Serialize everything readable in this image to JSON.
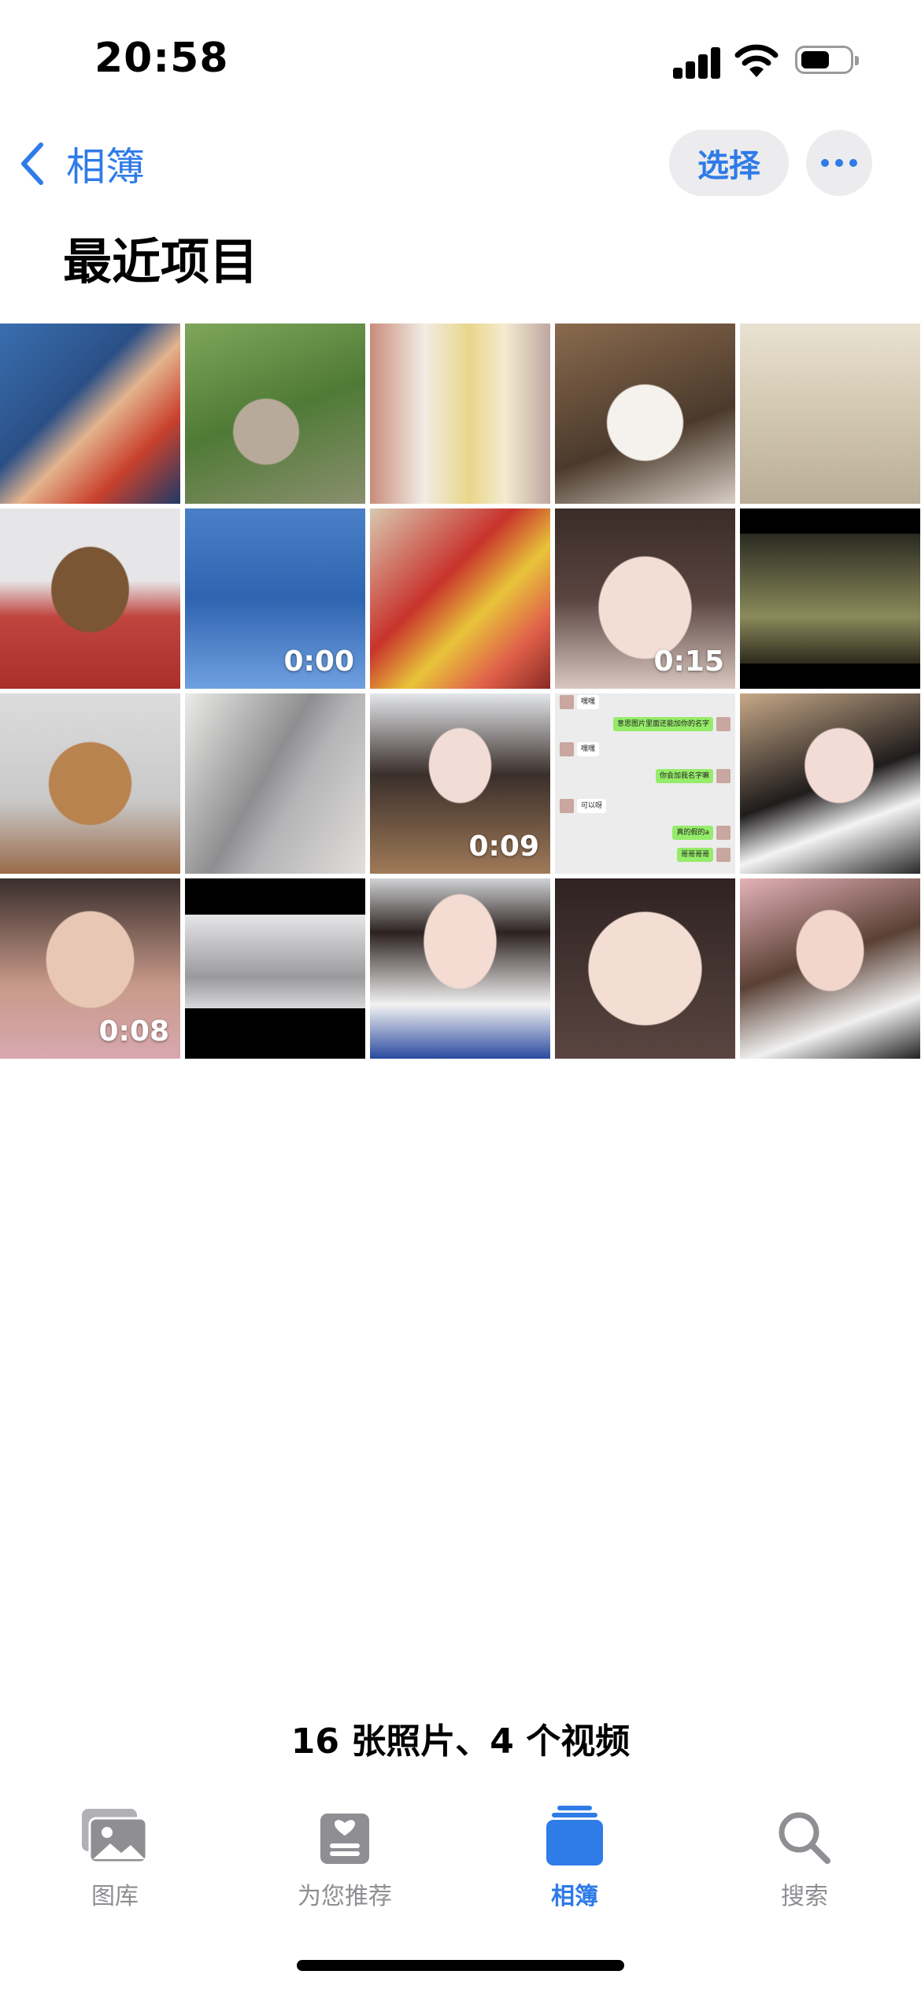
{
  "status_bar": {
    "time": "20:58",
    "battery_level": 0.6
  },
  "nav": {
    "back_label": "相簿",
    "select_label": "选择"
  },
  "page_title": "最近项目",
  "grid": [
    {
      "kind": "photo",
      "subject": "cartoon boy"
    },
    {
      "kind": "photo",
      "subject": "cat on grass"
    },
    {
      "kind": "photo",
      "subject": "two people on phone"
    },
    {
      "kind": "photo",
      "subject": "husky dog"
    },
    {
      "kind": "photo",
      "subject": "street scene"
    },
    {
      "kind": "photo",
      "subject": "dog on red carpet"
    },
    {
      "kind": "video",
      "subject": "blue water",
      "duration": "0:00"
    },
    {
      "kind": "photo",
      "subject": "snacks package"
    },
    {
      "kind": "video",
      "subject": "selfie",
      "duration": "0:15"
    },
    {
      "kind": "photo",
      "subject": "person outdoors at night"
    },
    {
      "kind": "photo",
      "subject": "dog with cap"
    },
    {
      "kind": "photo",
      "subject": "cat and person"
    },
    {
      "kind": "video",
      "subject": "selfie",
      "duration": "0:09"
    },
    {
      "kind": "photo",
      "subject": "chat screenshot"
    },
    {
      "kind": "photo",
      "subject": "peace sign selfie"
    },
    {
      "kind": "video",
      "subject": "selfie",
      "duration": "0:08"
    },
    {
      "kind": "photo",
      "subject": "cat and person"
    },
    {
      "kind": "photo",
      "subject": "selfie with glasses"
    },
    {
      "kind": "photo",
      "subject": "face close-up"
    },
    {
      "kind": "photo",
      "subject": "selfie with glasses"
    }
  ],
  "chat": {
    "messages": [
      {
        "side": "left",
        "text": "嘿嘿"
      },
      {
        "side": "right",
        "text": "意思图片里面还能加你的名字"
      },
      {
        "side": "left",
        "text": "嘿嘿"
      },
      {
        "side": "right",
        "text": "你会加我名字嘛"
      },
      {
        "side": "left",
        "text": "可以呀"
      },
      {
        "side": "right",
        "text": "真的假的a"
      },
      {
        "side": "right",
        "text": "哥哥哥哥"
      }
    ]
  },
  "summary": "16 张照片、4 个视频",
  "tabs": [
    {
      "label": "图库",
      "icon": "photos-icon",
      "active": false
    },
    {
      "label": "为您推荐",
      "icon": "for-you-icon",
      "active": false
    },
    {
      "label": "相簿",
      "icon": "albums-icon",
      "active": true
    },
    {
      "label": "搜索",
      "icon": "search-icon",
      "active": false
    }
  ],
  "colors": {
    "accent": "#2f7be8",
    "pill_bg": "#ececee",
    "inactive": "#8e8e93"
  }
}
